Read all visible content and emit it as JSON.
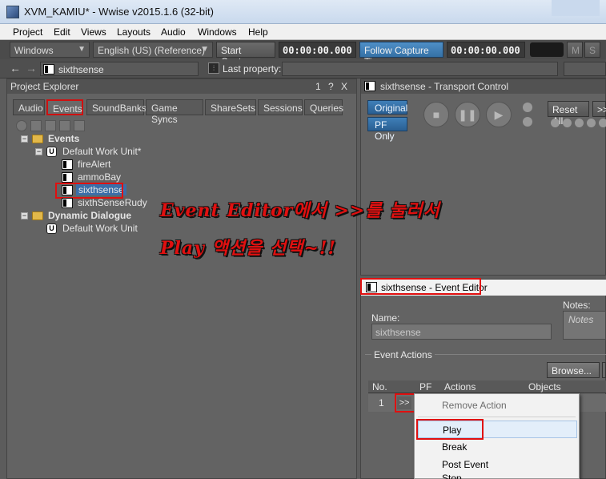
{
  "window": {
    "title": "XVM_KAMIU* - Wwise v2015.1.6 (32-bit)"
  },
  "menu": [
    "Project",
    "Edit",
    "Views",
    "Layouts",
    "Audio",
    "Windows",
    "Help"
  ],
  "toolbar": {
    "platform": "Windows",
    "language": "English (US) (Reference)",
    "start_capture": "Start Capture",
    "time1": "00:00:00.000",
    "follow_capture": "Follow Capture Time",
    "time2": "00:00:00.000",
    "m": "M",
    "s": "S"
  },
  "row2": {
    "current_object": "sixthsense",
    "last_property_label": "Last property:"
  },
  "project_explorer": {
    "title": "Project Explorer",
    "title_extra": "1 ? X",
    "tabs": [
      "Audio",
      "Events",
      "SoundBanks",
      "Game Syncs",
      "ShareSets",
      "Sessions",
      "Queries"
    ],
    "active_tab": "Events",
    "tree": {
      "events_folder": "Events",
      "work_unit": "Default Work Unit*",
      "items": [
        "fireAlert",
        "ammoBay",
        "sixthsense",
        "sixthSenseRudy"
      ],
      "selected": "sixthsense",
      "dialogue_folder": "Dynamic Dialogue",
      "dialogue_work_unit": "Default Work Unit"
    }
  },
  "transport": {
    "title": "sixthsense - Transport Control",
    "original": "Original",
    "pf_only": "PF Only",
    "reset_all": "Reset All",
    "more": ">>"
  },
  "annotation": {
    "line1": "Event Editor에서 >>를 눌러서",
    "line2": "Play 액션을 선택~!!"
  },
  "event_editor": {
    "title": "sixthsense - Event Editor",
    "name_label": "Name:",
    "name_value": "sixthsense",
    "notes_label": "Notes:",
    "notes_placeholder": "Notes",
    "event_actions_label": "Event Actions",
    "browse": "Browse...",
    "columns": [
      "No.",
      "",
      "PF",
      "Actions",
      "Objects"
    ],
    "row": {
      "no": "1",
      "expand": ">>"
    }
  },
  "context_menu": {
    "items": [
      "Remove Action",
      "Play",
      "Break",
      "Post Event",
      "Stop"
    ],
    "highlighted": "Play",
    "disabled": "Remove Action"
  }
}
